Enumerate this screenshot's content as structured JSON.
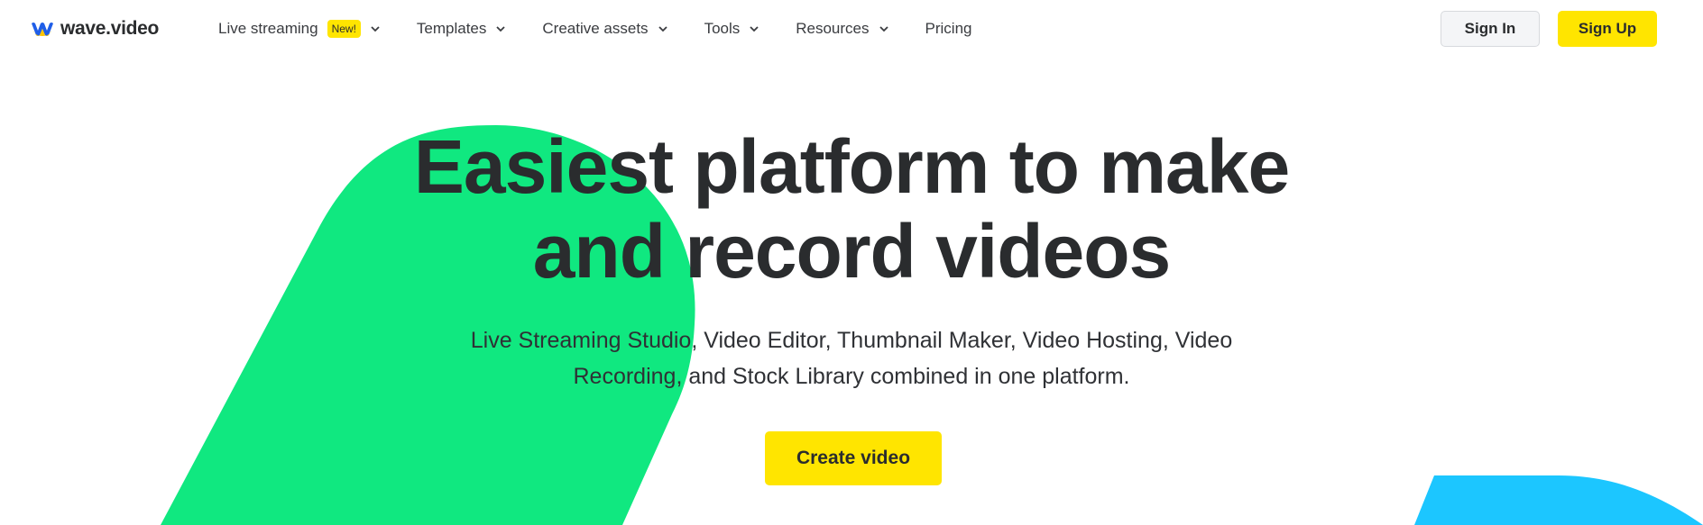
{
  "brand": {
    "name": "wave.video",
    "colors": {
      "accent": "#ffe500",
      "green": "#10e880",
      "blue": "#1cc6ff",
      "text": "#2a2c2e"
    }
  },
  "nav": {
    "items": [
      {
        "label": "Live streaming",
        "badge": "New!",
        "has_dropdown": true
      },
      {
        "label": "Templates",
        "has_dropdown": true
      },
      {
        "label": "Creative assets",
        "has_dropdown": true
      },
      {
        "label": "Tools",
        "has_dropdown": true
      },
      {
        "label": "Resources",
        "has_dropdown": true
      },
      {
        "label": "Pricing",
        "has_dropdown": false
      }
    ],
    "sign_in": "Sign In",
    "sign_up": "Sign Up"
  },
  "hero": {
    "title_line1": "Easiest platform to make",
    "title_line2": "and record videos",
    "subtitle_line1": "Live Streaming Studio, Video Editor, Thumbnail Maker, Video Hosting, Video",
    "subtitle_line2": "Recording, and Stock Library combined in one platform.",
    "cta": "Create video"
  },
  "icons": {
    "dropdown": "chevron-down-icon",
    "logo": "wave-logo-icon"
  }
}
